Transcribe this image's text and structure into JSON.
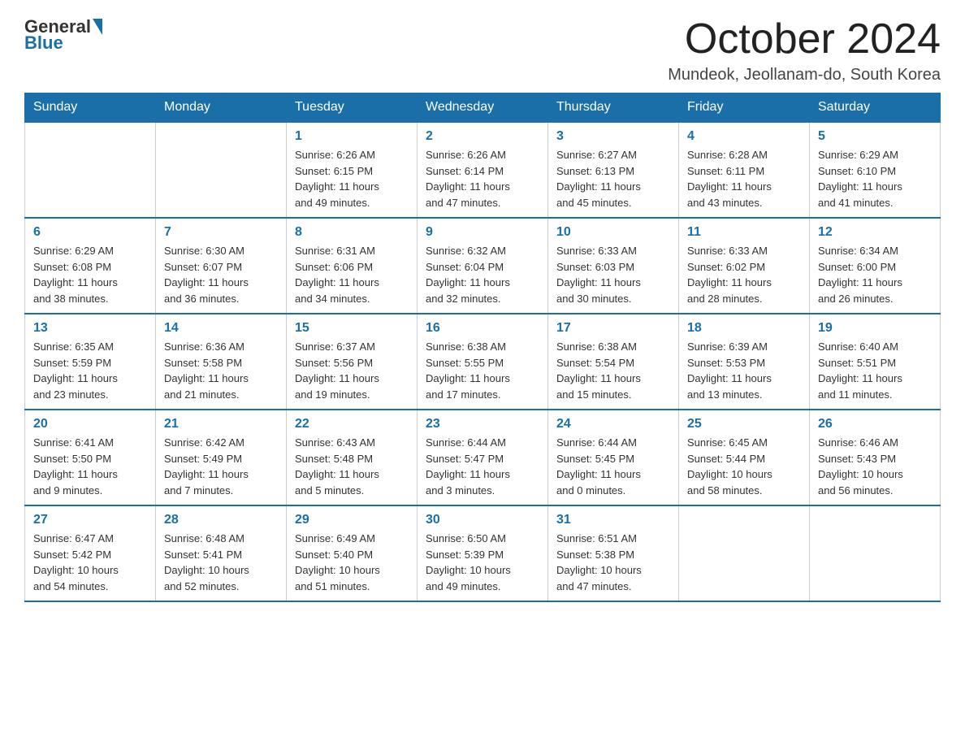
{
  "header": {
    "logo_general": "General",
    "logo_blue": "Blue",
    "month_title": "October 2024",
    "location": "Mundeok, Jeollanam-do, South Korea"
  },
  "weekdays": [
    "Sunday",
    "Monday",
    "Tuesday",
    "Wednesday",
    "Thursday",
    "Friday",
    "Saturday"
  ],
  "weeks": [
    [
      {
        "day": "",
        "info": ""
      },
      {
        "day": "",
        "info": ""
      },
      {
        "day": "1",
        "info": "Sunrise: 6:26 AM\nSunset: 6:15 PM\nDaylight: 11 hours\nand 49 minutes."
      },
      {
        "day": "2",
        "info": "Sunrise: 6:26 AM\nSunset: 6:14 PM\nDaylight: 11 hours\nand 47 minutes."
      },
      {
        "day": "3",
        "info": "Sunrise: 6:27 AM\nSunset: 6:13 PM\nDaylight: 11 hours\nand 45 minutes."
      },
      {
        "day": "4",
        "info": "Sunrise: 6:28 AM\nSunset: 6:11 PM\nDaylight: 11 hours\nand 43 minutes."
      },
      {
        "day": "5",
        "info": "Sunrise: 6:29 AM\nSunset: 6:10 PM\nDaylight: 11 hours\nand 41 minutes."
      }
    ],
    [
      {
        "day": "6",
        "info": "Sunrise: 6:29 AM\nSunset: 6:08 PM\nDaylight: 11 hours\nand 38 minutes."
      },
      {
        "day": "7",
        "info": "Sunrise: 6:30 AM\nSunset: 6:07 PM\nDaylight: 11 hours\nand 36 minutes."
      },
      {
        "day": "8",
        "info": "Sunrise: 6:31 AM\nSunset: 6:06 PM\nDaylight: 11 hours\nand 34 minutes."
      },
      {
        "day": "9",
        "info": "Sunrise: 6:32 AM\nSunset: 6:04 PM\nDaylight: 11 hours\nand 32 minutes."
      },
      {
        "day": "10",
        "info": "Sunrise: 6:33 AM\nSunset: 6:03 PM\nDaylight: 11 hours\nand 30 minutes."
      },
      {
        "day": "11",
        "info": "Sunrise: 6:33 AM\nSunset: 6:02 PM\nDaylight: 11 hours\nand 28 minutes."
      },
      {
        "day": "12",
        "info": "Sunrise: 6:34 AM\nSunset: 6:00 PM\nDaylight: 11 hours\nand 26 minutes."
      }
    ],
    [
      {
        "day": "13",
        "info": "Sunrise: 6:35 AM\nSunset: 5:59 PM\nDaylight: 11 hours\nand 23 minutes."
      },
      {
        "day": "14",
        "info": "Sunrise: 6:36 AM\nSunset: 5:58 PM\nDaylight: 11 hours\nand 21 minutes."
      },
      {
        "day": "15",
        "info": "Sunrise: 6:37 AM\nSunset: 5:56 PM\nDaylight: 11 hours\nand 19 minutes."
      },
      {
        "day": "16",
        "info": "Sunrise: 6:38 AM\nSunset: 5:55 PM\nDaylight: 11 hours\nand 17 minutes."
      },
      {
        "day": "17",
        "info": "Sunrise: 6:38 AM\nSunset: 5:54 PM\nDaylight: 11 hours\nand 15 minutes."
      },
      {
        "day": "18",
        "info": "Sunrise: 6:39 AM\nSunset: 5:53 PM\nDaylight: 11 hours\nand 13 minutes."
      },
      {
        "day": "19",
        "info": "Sunrise: 6:40 AM\nSunset: 5:51 PM\nDaylight: 11 hours\nand 11 minutes."
      }
    ],
    [
      {
        "day": "20",
        "info": "Sunrise: 6:41 AM\nSunset: 5:50 PM\nDaylight: 11 hours\nand 9 minutes."
      },
      {
        "day": "21",
        "info": "Sunrise: 6:42 AM\nSunset: 5:49 PM\nDaylight: 11 hours\nand 7 minutes."
      },
      {
        "day": "22",
        "info": "Sunrise: 6:43 AM\nSunset: 5:48 PM\nDaylight: 11 hours\nand 5 minutes."
      },
      {
        "day": "23",
        "info": "Sunrise: 6:44 AM\nSunset: 5:47 PM\nDaylight: 11 hours\nand 3 minutes."
      },
      {
        "day": "24",
        "info": "Sunrise: 6:44 AM\nSunset: 5:45 PM\nDaylight: 11 hours\nand 0 minutes."
      },
      {
        "day": "25",
        "info": "Sunrise: 6:45 AM\nSunset: 5:44 PM\nDaylight: 10 hours\nand 58 minutes."
      },
      {
        "day": "26",
        "info": "Sunrise: 6:46 AM\nSunset: 5:43 PM\nDaylight: 10 hours\nand 56 minutes."
      }
    ],
    [
      {
        "day": "27",
        "info": "Sunrise: 6:47 AM\nSunset: 5:42 PM\nDaylight: 10 hours\nand 54 minutes."
      },
      {
        "day": "28",
        "info": "Sunrise: 6:48 AM\nSunset: 5:41 PM\nDaylight: 10 hours\nand 52 minutes."
      },
      {
        "day": "29",
        "info": "Sunrise: 6:49 AM\nSunset: 5:40 PM\nDaylight: 10 hours\nand 51 minutes."
      },
      {
        "day": "30",
        "info": "Sunrise: 6:50 AM\nSunset: 5:39 PM\nDaylight: 10 hours\nand 49 minutes."
      },
      {
        "day": "31",
        "info": "Sunrise: 6:51 AM\nSunset: 5:38 PM\nDaylight: 10 hours\nand 47 minutes."
      },
      {
        "day": "",
        "info": ""
      },
      {
        "day": "",
        "info": ""
      }
    ]
  ]
}
